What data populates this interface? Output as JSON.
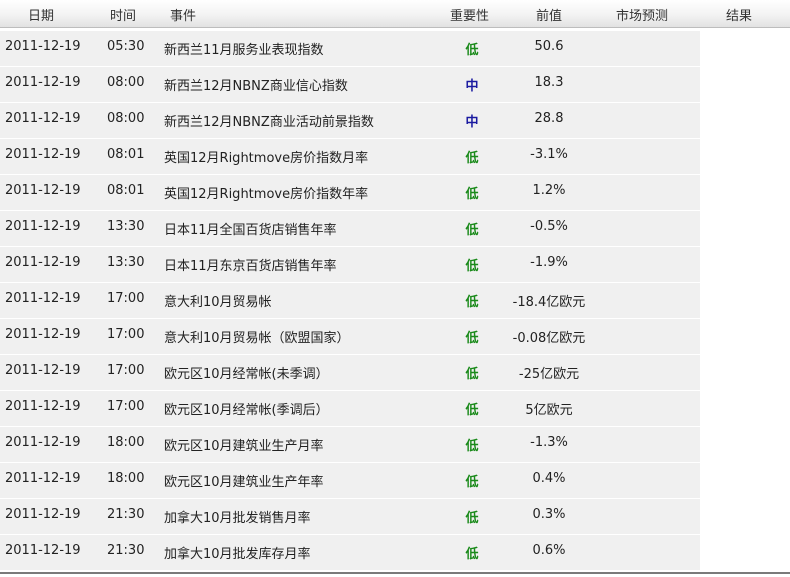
{
  "header": {
    "date": "日期",
    "time": "时间",
    "event": "事件",
    "importance": "重要性",
    "previous": "前值",
    "forecast": "市场预测",
    "result": "结果"
  },
  "colors": {
    "low": "#1a8a1a",
    "medium": "#1a1aa0",
    "row_background": "#f0f0f0"
  },
  "rows": [
    {
      "date": "2011-12-19",
      "time": "05:30",
      "event": "新西兰11月服务业表现指数",
      "importance": "低",
      "level": "low",
      "previous": "50.6"
    },
    {
      "date": "2011-12-19",
      "time": "08:00",
      "event": "新西兰12月NBNZ商业信心指数",
      "importance": "中",
      "level": "medium",
      "previous": "18.3"
    },
    {
      "date": "2011-12-19",
      "time": "08:00",
      "event": "新西兰12月NBNZ商业活动前景指数",
      "importance": "中",
      "level": "medium",
      "previous": "28.8"
    },
    {
      "date": "2011-12-19",
      "time": "08:01",
      "event": "英国12月Rightmove房价指数月率",
      "importance": "低",
      "level": "low",
      "previous": "-3.1%"
    },
    {
      "date": "2011-12-19",
      "time": "08:01",
      "event": "英国12月Rightmove房价指数年率",
      "importance": "低",
      "level": "low",
      "previous": "1.2%"
    },
    {
      "date": "2011-12-19",
      "time": "13:30",
      "event": "日本11月全国百货店销售年率",
      "importance": "低",
      "level": "low",
      "previous": "-0.5%"
    },
    {
      "date": "2011-12-19",
      "time": "13:30",
      "event": "日本11月东京百货店销售年率",
      "importance": "低",
      "level": "low",
      "previous": "-1.9%"
    },
    {
      "date": "2011-12-19",
      "time": "17:00",
      "event": "意大利10月贸易帐",
      "importance": "低",
      "level": "low",
      "previous": "-18.4亿欧元"
    },
    {
      "date": "2011-12-19",
      "time": "17:00",
      "event": "意大利10月贸易帐（欧盟国家）",
      "importance": "低",
      "level": "low",
      "previous": "-0.08亿欧元"
    },
    {
      "date": "2011-12-19",
      "time": "17:00",
      "event": "欧元区10月经常帐(未季调）",
      "importance": "低",
      "level": "low",
      "previous": "-25亿欧元"
    },
    {
      "date": "2011-12-19",
      "time": "17:00",
      "event": "欧元区10月经常帐(季调后）",
      "importance": "低",
      "level": "low",
      "previous": "5亿欧元"
    },
    {
      "date": "2011-12-19",
      "time": "18:00",
      "event": "欧元区10月建筑业生产月率",
      "importance": "低",
      "level": "low",
      "previous": "-1.3%"
    },
    {
      "date": "2011-12-19",
      "time": "18:00",
      "event": "欧元区10月建筑业生产年率",
      "importance": "低",
      "level": "low",
      "previous": "0.4%"
    },
    {
      "date": "2011-12-19",
      "time": "21:30",
      "event": "加拿大10月批发销售月率",
      "importance": "低",
      "level": "low",
      "previous": "0.3%"
    },
    {
      "date": "2011-12-19",
      "time": "21:30",
      "event": "加拿大10月批发库存月率",
      "importance": "低",
      "level": "low",
      "previous": "0.6%"
    }
  ]
}
